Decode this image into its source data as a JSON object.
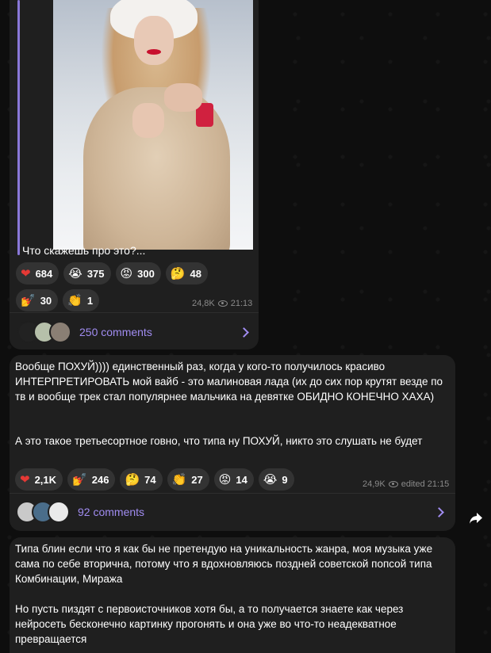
{
  "post1": {
    "caption": "Что скажешь про это?...",
    "reactions": [
      {
        "emoji": "❤",
        "count": "684"
      },
      {
        "emoji": "😭",
        "count": "375"
      },
      {
        "emoji": "😡",
        "count": "300"
      },
      {
        "emoji": "🤔",
        "count": "48"
      },
      {
        "emoji": "💅",
        "count": "30"
      },
      {
        "emoji": "👏",
        "count": "1"
      }
    ],
    "views": "24,8K",
    "time": "21:13",
    "comments_label": "250 comments"
  },
  "post2": {
    "text_p1": "Вообще ПОХУЙ)))) единственный раз, когда у кого-то получилось красиво ИНТЕРПРЕТИРОВАТЬ мой вайб - это малиновая лада (их до сих пор крутят везде по тв и вообще трек стал популярнее мальчика на девятке ОБИДНО КОНЕЧНО ХАХА)",
    "text_p2": "А это такое третьесортное говно, что типа ну ПОХУЙ, никто это слушать не будет",
    "reactions": [
      {
        "emoji": "❤",
        "count": "2,1K"
      },
      {
        "emoji": "💅",
        "count": "246"
      },
      {
        "emoji": "🤔",
        "count": "74"
      },
      {
        "emoji": "👏",
        "count": "27"
      },
      {
        "emoji": "😡",
        "count": "14"
      },
      {
        "emoji": "😭",
        "count": "9"
      }
    ],
    "views": "24,9K",
    "time": "edited 21:15",
    "comments_label": "92 comments"
  },
  "post3": {
    "text_p1": "Типа блин если что я как бы не претендую на уникальность жанра, моя музыка уже сама по себе вторична, потому что я вдохновляюсь поздней советской попсой типа Комбинации, Миража",
    "text_p2": "Но пусть пиздят с первоисточников хотя бы, а то получается знаете как через нейросеть бесконечно картинку прогонять и она уже во что-то неадекватное превращается"
  },
  "colors": {
    "accent": "#a08cf0",
    "bubble": "#1f1f1f",
    "reaction_bg": "#333333"
  }
}
